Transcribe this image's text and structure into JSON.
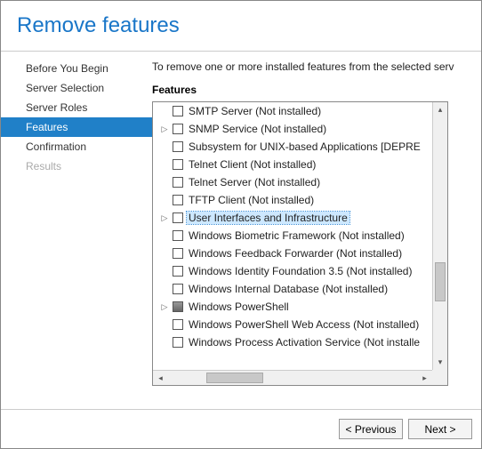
{
  "header": {
    "title": "Remove features"
  },
  "sidebar": {
    "items": [
      {
        "label": "Before You Begin",
        "active": false,
        "disabled": false
      },
      {
        "label": "Server Selection",
        "active": false,
        "disabled": false
      },
      {
        "label": "Server Roles",
        "active": false,
        "disabled": false
      },
      {
        "label": "Features",
        "active": true,
        "disabled": false
      },
      {
        "label": "Confirmation",
        "active": false,
        "disabled": false
      },
      {
        "label": "Results",
        "active": false,
        "disabled": true
      }
    ]
  },
  "main": {
    "instruction": "To remove one or more installed features from the selected serv",
    "section_label": "Features",
    "features": [
      {
        "expander": "",
        "label": "SMTP Server (Not installed)",
        "selected": false,
        "checked": false
      },
      {
        "expander": "▷",
        "label": "SNMP Service (Not installed)",
        "selected": false,
        "checked": false
      },
      {
        "expander": "",
        "label": "Subsystem for UNIX-based Applications [DEPRE",
        "selected": false,
        "checked": false
      },
      {
        "expander": "",
        "label": "Telnet Client (Not installed)",
        "selected": false,
        "checked": false
      },
      {
        "expander": "",
        "label": "Telnet Server (Not installed)",
        "selected": false,
        "checked": false
      },
      {
        "expander": "",
        "label": "TFTP Client (Not installed)",
        "selected": false,
        "checked": false
      },
      {
        "expander": "▷",
        "label": "User Interfaces and Infrastructure",
        "selected": true,
        "checked": false
      },
      {
        "expander": "",
        "label": "Windows Biometric Framework (Not installed)",
        "selected": false,
        "checked": false
      },
      {
        "expander": "",
        "label": "Windows Feedback Forwarder (Not installed)",
        "selected": false,
        "checked": false
      },
      {
        "expander": "",
        "label": "Windows Identity Foundation 3.5 (Not installed)",
        "selected": false,
        "checked": false
      },
      {
        "expander": "",
        "label": "Windows Internal Database (Not installed)",
        "selected": false,
        "checked": false
      },
      {
        "expander": "▷",
        "label": "Windows PowerShell",
        "selected": false,
        "checked": "filled"
      },
      {
        "expander": "",
        "label": "Windows PowerShell Web Access (Not installed)",
        "selected": false,
        "checked": false
      },
      {
        "expander": "",
        "label": "Windows Process Activation Service (Not installe",
        "selected": false,
        "checked": false
      }
    ]
  },
  "footer": {
    "previous": "< Previous",
    "next": "Next >"
  }
}
